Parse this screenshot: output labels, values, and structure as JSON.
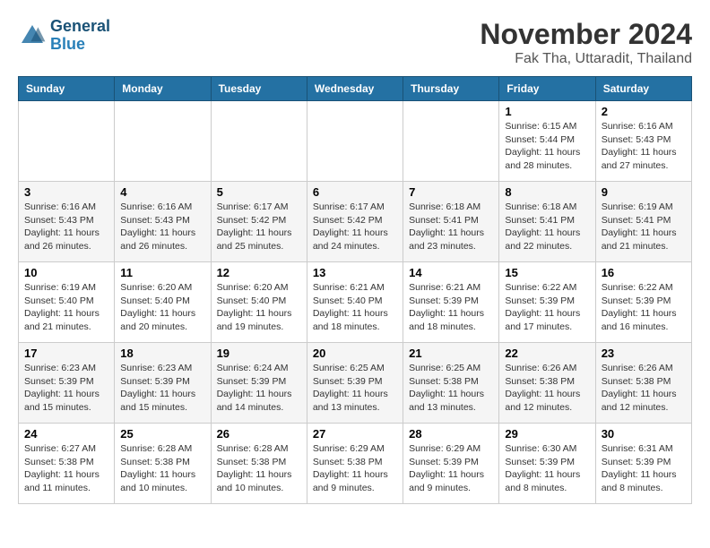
{
  "header": {
    "logo_line1": "General",
    "logo_line2": "Blue",
    "month": "November 2024",
    "location": "Fak Tha, Uttaradit, Thailand"
  },
  "weekdays": [
    "Sunday",
    "Monday",
    "Tuesday",
    "Wednesday",
    "Thursday",
    "Friday",
    "Saturday"
  ],
  "weeks": [
    [
      {
        "day": "",
        "sunrise": "",
        "sunset": "",
        "daylight": ""
      },
      {
        "day": "",
        "sunrise": "",
        "sunset": "",
        "daylight": ""
      },
      {
        "day": "",
        "sunrise": "",
        "sunset": "",
        "daylight": ""
      },
      {
        "day": "",
        "sunrise": "",
        "sunset": "",
        "daylight": ""
      },
      {
        "day": "",
        "sunrise": "",
        "sunset": "",
        "daylight": ""
      },
      {
        "day": "1",
        "sunrise": "Sunrise: 6:15 AM",
        "sunset": "Sunset: 5:44 PM",
        "daylight": "Daylight: 11 hours and 28 minutes."
      },
      {
        "day": "2",
        "sunrise": "Sunrise: 6:16 AM",
        "sunset": "Sunset: 5:43 PM",
        "daylight": "Daylight: 11 hours and 27 minutes."
      }
    ],
    [
      {
        "day": "3",
        "sunrise": "Sunrise: 6:16 AM",
        "sunset": "Sunset: 5:43 PM",
        "daylight": "Daylight: 11 hours and 26 minutes."
      },
      {
        "day": "4",
        "sunrise": "Sunrise: 6:16 AM",
        "sunset": "Sunset: 5:43 PM",
        "daylight": "Daylight: 11 hours and 26 minutes."
      },
      {
        "day": "5",
        "sunrise": "Sunrise: 6:17 AM",
        "sunset": "Sunset: 5:42 PM",
        "daylight": "Daylight: 11 hours and 25 minutes."
      },
      {
        "day": "6",
        "sunrise": "Sunrise: 6:17 AM",
        "sunset": "Sunset: 5:42 PM",
        "daylight": "Daylight: 11 hours and 24 minutes."
      },
      {
        "day": "7",
        "sunrise": "Sunrise: 6:18 AM",
        "sunset": "Sunset: 5:41 PM",
        "daylight": "Daylight: 11 hours and 23 minutes."
      },
      {
        "day": "8",
        "sunrise": "Sunrise: 6:18 AM",
        "sunset": "Sunset: 5:41 PM",
        "daylight": "Daylight: 11 hours and 22 minutes."
      },
      {
        "day": "9",
        "sunrise": "Sunrise: 6:19 AM",
        "sunset": "Sunset: 5:41 PM",
        "daylight": "Daylight: 11 hours and 21 minutes."
      }
    ],
    [
      {
        "day": "10",
        "sunrise": "Sunrise: 6:19 AM",
        "sunset": "Sunset: 5:40 PM",
        "daylight": "Daylight: 11 hours and 21 minutes."
      },
      {
        "day": "11",
        "sunrise": "Sunrise: 6:20 AM",
        "sunset": "Sunset: 5:40 PM",
        "daylight": "Daylight: 11 hours and 20 minutes."
      },
      {
        "day": "12",
        "sunrise": "Sunrise: 6:20 AM",
        "sunset": "Sunset: 5:40 PM",
        "daylight": "Daylight: 11 hours and 19 minutes."
      },
      {
        "day": "13",
        "sunrise": "Sunrise: 6:21 AM",
        "sunset": "Sunset: 5:40 PM",
        "daylight": "Daylight: 11 hours and 18 minutes."
      },
      {
        "day": "14",
        "sunrise": "Sunrise: 6:21 AM",
        "sunset": "Sunset: 5:39 PM",
        "daylight": "Daylight: 11 hours and 18 minutes."
      },
      {
        "day": "15",
        "sunrise": "Sunrise: 6:22 AM",
        "sunset": "Sunset: 5:39 PM",
        "daylight": "Daylight: 11 hours and 17 minutes."
      },
      {
        "day": "16",
        "sunrise": "Sunrise: 6:22 AM",
        "sunset": "Sunset: 5:39 PM",
        "daylight": "Daylight: 11 hours and 16 minutes."
      }
    ],
    [
      {
        "day": "17",
        "sunrise": "Sunrise: 6:23 AM",
        "sunset": "Sunset: 5:39 PM",
        "daylight": "Daylight: 11 hours and 15 minutes."
      },
      {
        "day": "18",
        "sunrise": "Sunrise: 6:23 AM",
        "sunset": "Sunset: 5:39 PM",
        "daylight": "Daylight: 11 hours and 15 minutes."
      },
      {
        "day": "19",
        "sunrise": "Sunrise: 6:24 AM",
        "sunset": "Sunset: 5:39 PM",
        "daylight": "Daylight: 11 hours and 14 minutes."
      },
      {
        "day": "20",
        "sunrise": "Sunrise: 6:25 AM",
        "sunset": "Sunset: 5:39 PM",
        "daylight": "Daylight: 11 hours and 13 minutes."
      },
      {
        "day": "21",
        "sunrise": "Sunrise: 6:25 AM",
        "sunset": "Sunset: 5:38 PM",
        "daylight": "Daylight: 11 hours and 13 minutes."
      },
      {
        "day": "22",
        "sunrise": "Sunrise: 6:26 AM",
        "sunset": "Sunset: 5:38 PM",
        "daylight": "Daylight: 11 hours and 12 minutes."
      },
      {
        "day": "23",
        "sunrise": "Sunrise: 6:26 AM",
        "sunset": "Sunset: 5:38 PM",
        "daylight": "Daylight: 11 hours and 12 minutes."
      }
    ],
    [
      {
        "day": "24",
        "sunrise": "Sunrise: 6:27 AM",
        "sunset": "Sunset: 5:38 PM",
        "daylight": "Daylight: 11 hours and 11 minutes."
      },
      {
        "day": "25",
        "sunrise": "Sunrise: 6:28 AM",
        "sunset": "Sunset: 5:38 PM",
        "daylight": "Daylight: 11 hours and 10 minutes."
      },
      {
        "day": "26",
        "sunrise": "Sunrise: 6:28 AM",
        "sunset": "Sunset: 5:38 PM",
        "daylight": "Daylight: 11 hours and 10 minutes."
      },
      {
        "day": "27",
        "sunrise": "Sunrise: 6:29 AM",
        "sunset": "Sunset: 5:38 PM",
        "daylight": "Daylight: 11 hours and 9 minutes."
      },
      {
        "day": "28",
        "sunrise": "Sunrise: 6:29 AM",
        "sunset": "Sunset: 5:39 PM",
        "daylight": "Daylight: 11 hours and 9 minutes."
      },
      {
        "day": "29",
        "sunrise": "Sunrise: 6:30 AM",
        "sunset": "Sunset: 5:39 PM",
        "daylight": "Daylight: 11 hours and 8 minutes."
      },
      {
        "day": "30",
        "sunrise": "Sunrise: 6:31 AM",
        "sunset": "Sunset: 5:39 PM",
        "daylight": "Daylight: 11 hours and 8 minutes."
      }
    ]
  ]
}
